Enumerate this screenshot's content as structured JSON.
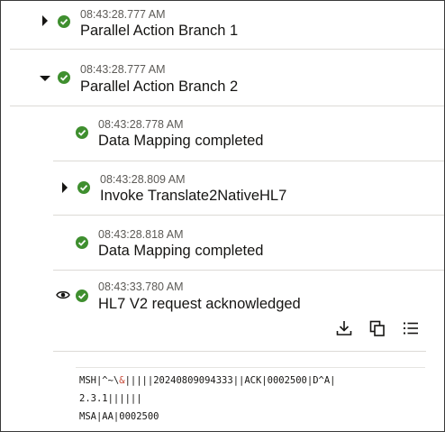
{
  "activity": [
    {
      "timestamp": "08:43:28.777 AM",
      "title": "Parallel Action Branch 1",
      "expander": "collapsed",
      "status": "success"
    },
    {
      "timestamp": "08:43:28.777 AM",
      "title": "Parallel Action Branch 2",
      "expander": "expanded",
      "status": "success"
    },
    {
      "timestamp": "08:43:28.778 AM",
      "title": "Data Mapping completed",
      "status": "success"
    },
    {
      "timestamp": "08:43:28.809 AM",
      "title": "Invoke Translate2NativeHL7",
      "expander": "collapsed",
      "status": "success"
    },
    {
      "timestamp": "08:43:28.818 AM",
      "title": "Data Mapping completed",
      "status": "success"
    },
    {
      "timestamp": "08:43:33.780 AM",
      "title": "HL7 V2 request acknowledged",
      "status": "success",
      "view_icon": "eye-icon"
    }
  ],
  "payload_toolbar": {
    "download_icon": "download-icon",
    "copy_icon": "copy-icon",
    "format_icon": "list-format-icon"
  },
  "payload": {
    "line1_pre": "MSH|^~\\",
    "line1_amp": "&",
    "line1_post": "|||||20240809094333||ACK|0002500|D^A|",
    "line2": "2.3.1||||||",
    "line3": "MSA|AA|0002500"
  },
  "colors": {
    "success": "#3f8f2f",
    "text": "#161513",
    "muted": "#5c5a56",
    "separator": "#dcdad6",
    "highlight": "#c74634"
  }
}
